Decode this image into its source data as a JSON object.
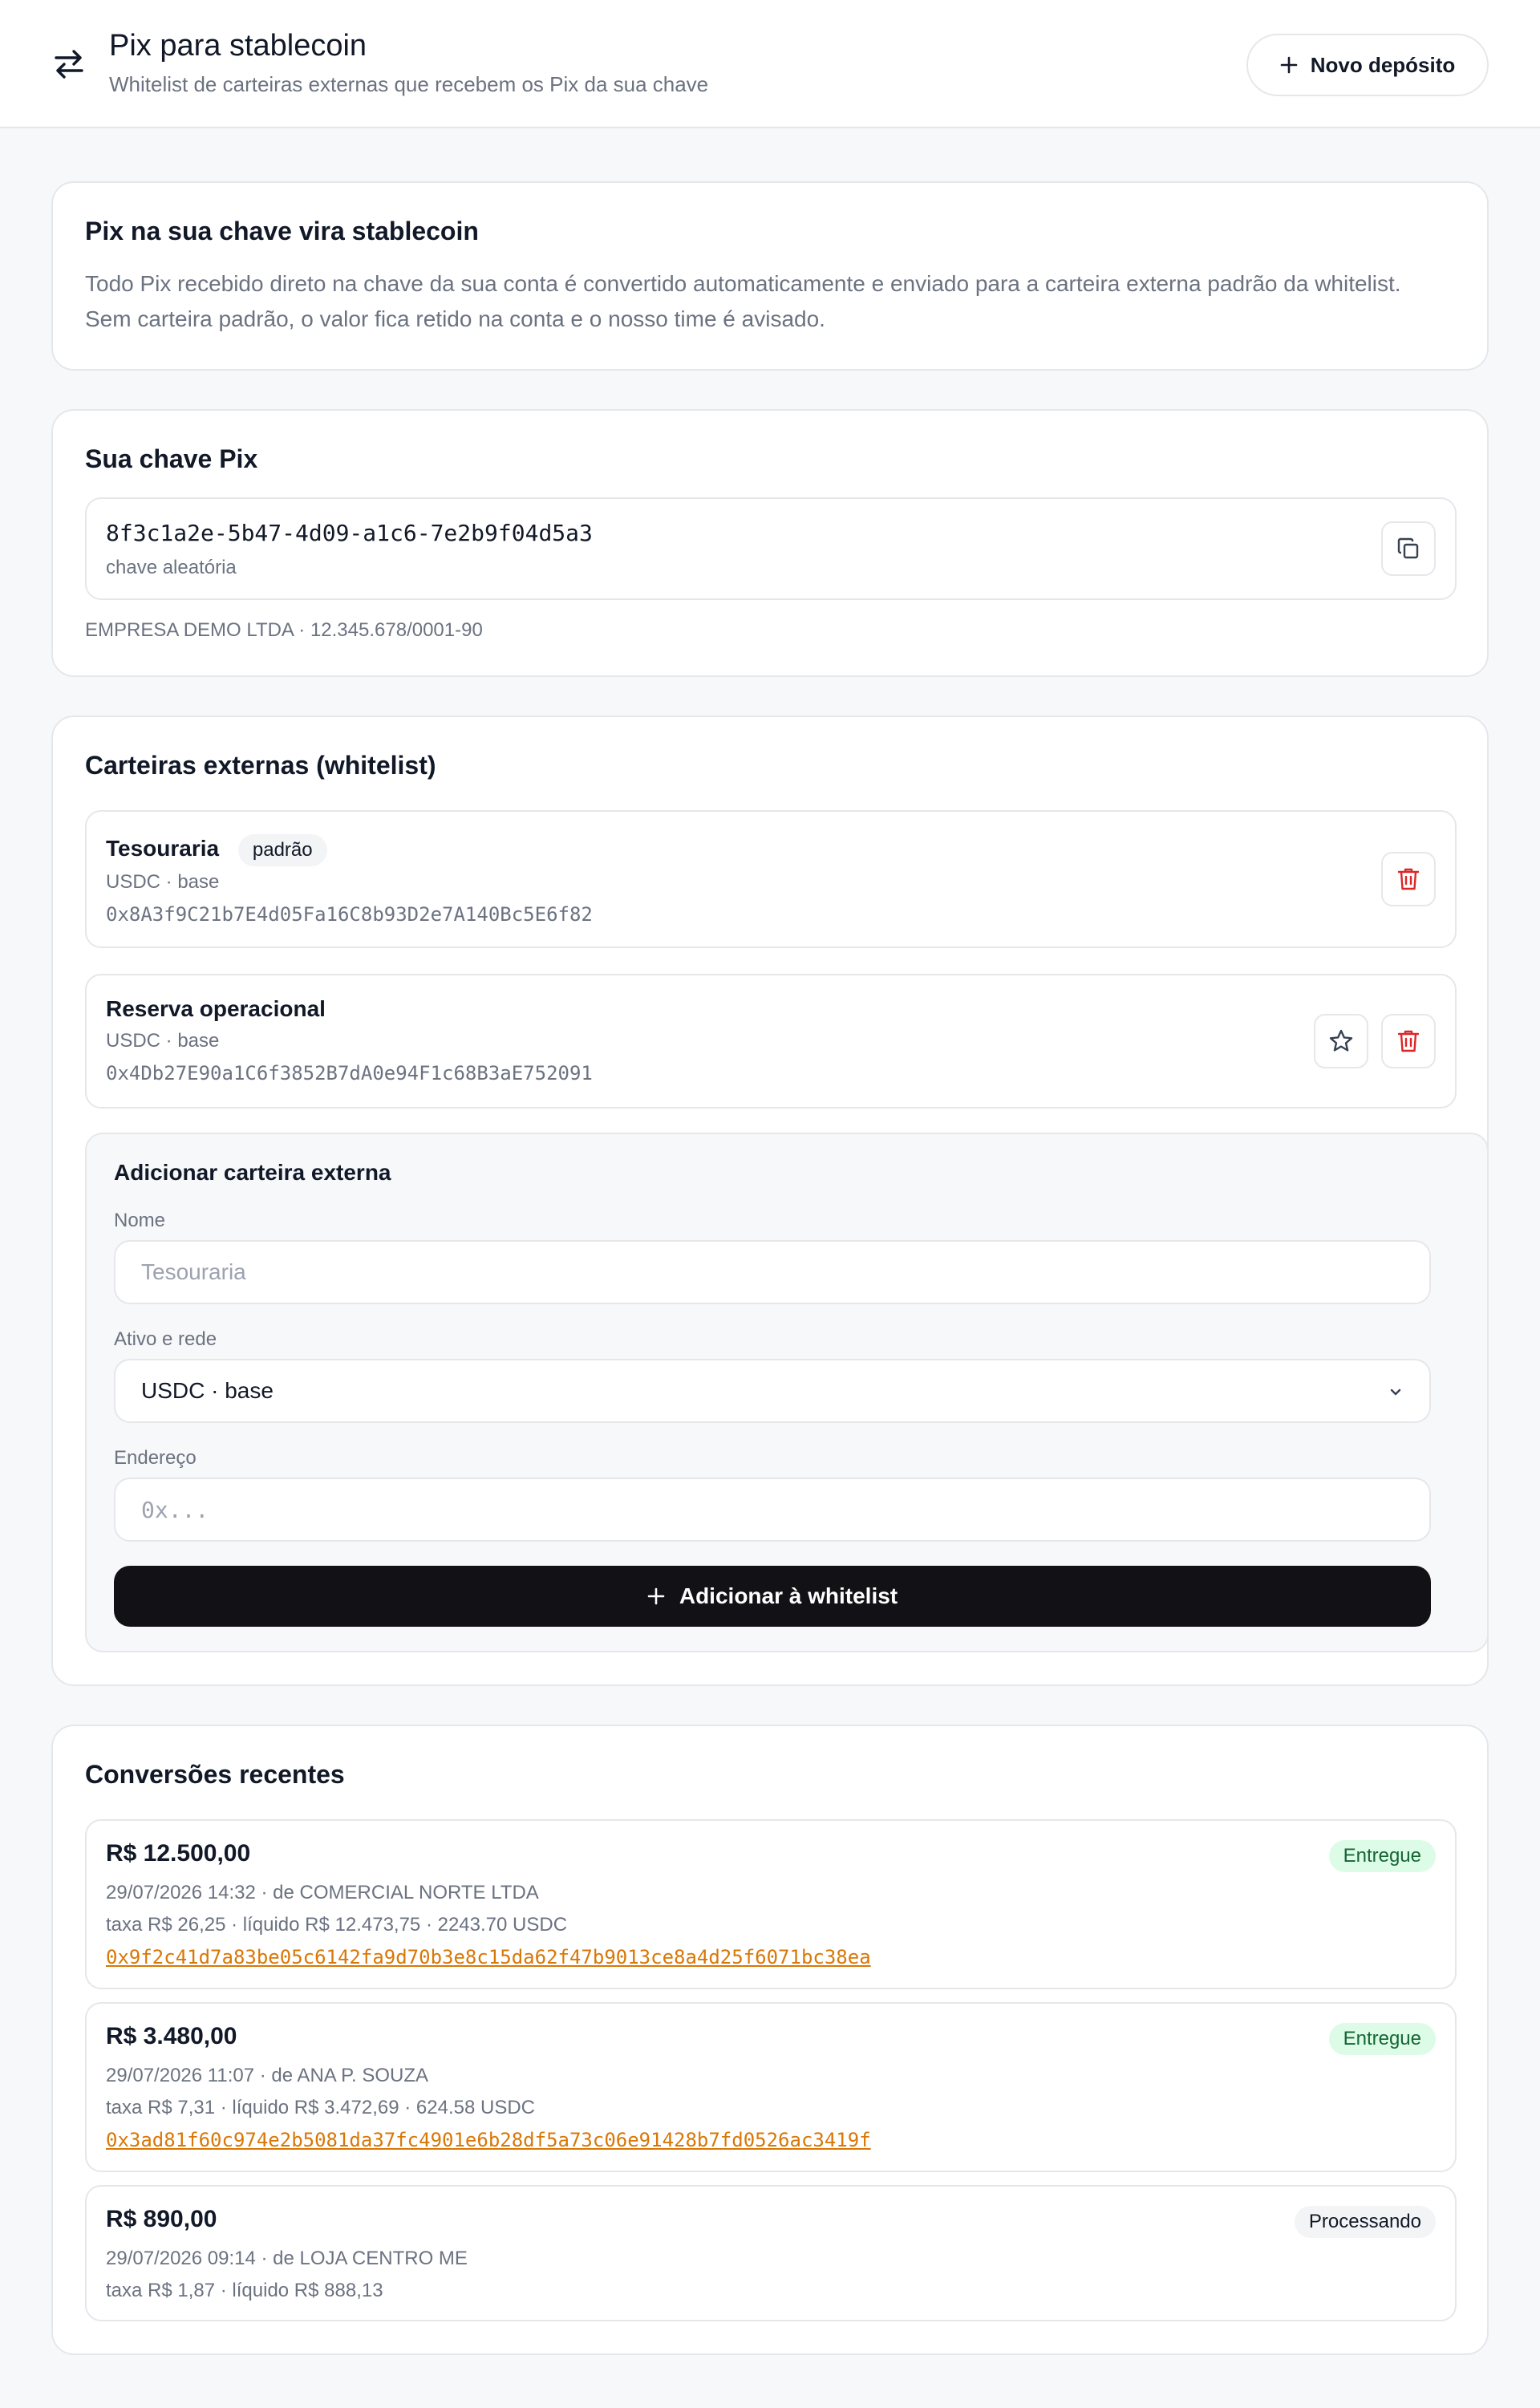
{
  "header": {
    "title": "Pix para stablecoin",
    "subtitle": "Whitelist de carteiras externas que recebem os Pix da sua chave",
    "icon": "arrows-left-right-icon",
    "new_deposit_label": "Novo depósito"
  },
  "intro": {
    "title": "Pix na sua chave vira stablecoin",
    "line1": "Todo Pix recebido direto na chave da sua conta é convertido automaticamente e enviado para a carteira externa padrão da whitelist.",
    "line2": "Sem carteira padrão, o valor fica retido na conta e o nosso time é avisado."
  },
  "pix_key": {
    "title": "Sua chave Pix",
    "key": "8f3c1a2e-5b47-4d09-a1c6-7e2b9f04d5a3",
    "key_type": "chave aleatória",
    "owner": "EMPRESA DEMO LTDA · 12.345.678/0001-90"
  },
  "wallets": {
    "title": "Carteiras externas (whitelist)",
    "items": [
      {
        "name": "Tesouraria",
        "badge": "padrão",
        "network": "USDC · base",
        "address": "0x8A3f9C21b7E4d05Fa16C8b93D2e7A140Bc5E6f82"
      },
      {
        "name": "Reserva operacional",
        "network": "USDC · base",
        "address": "0x4Db27E90a1C6f3852B7dA0e94F1c68B3aE752091"
      }
    ]
  },
  "add_wallet": {
    "title": "Adicionar carteira externa",
    "name_label": "Nome",
    "name_placeholder": "Tesouraria",
    "asset_label": "Ativo e rede",
    "asset_value": "USDC · base",
    "address_label": "Endereço",
    "address_placeholder": "0x...",
    "submit_label": "Adicionar à whitelist"
  },
  "conversions": {
    "title": "Conversões recentes",
    "items": [
      {
        "amount": "R$ 12.500,00",
        "status": "Entregue",
        "when_from": "29/07/2026 14:32 · de COMERCIAL NORTE LTDA",
        "fees": "taxa R$ 26,25 · líquido R$ 12.473,75 · 2243.70 USDC",
        "tx": "0x9f2c41d7a83be05c6142fa9d70b3e8c15da62f47b9013ce8a4d25f6071bc38ea"
      },
      {
        "amount": "R$ 3.480,00",
        "status": "Entregue",
        "when_from": "29/07/2026 11:07 · de ANA P. SOUZA",
        "fees": "taxa R$ 7,31 · líquido R$ 3.472,69 · 624.58 USDC",
        "tx": "0x3ad81f60c974e2b5081da37fc4901e6b28df5a73c06e91428b7fd0526ac3419f"
      },
      {
        "amount": "R$ 890,00",
        "status": "Processando",
        "when_from": "29/07/2026 09:14 · de LOJA CENTRO ME",
        "fees": "taxa R$ 1,87 · líquido R$ 888,13"
      }
    ]
  },
  "colors": {
    "accent_dark": "#111116",
    "link": "#d97706",
    "success_bg": "#dcfce7",
    "danger": "#dc2626"
  }
}
